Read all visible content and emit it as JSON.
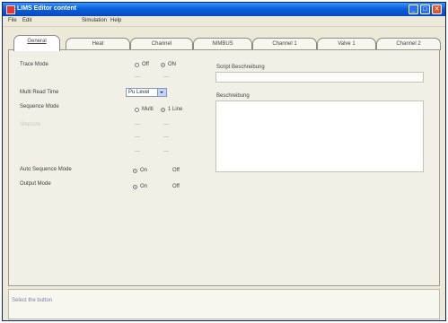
{
  "window": {
    "title": "LIMS Editor content",
    "controls": {
      "minimize": "_",
      "maximize": "□",
      "close": "✕"
    }
  },
  "menu": [
    "File",
    "Edit",
    "Simulation",
    "Help"
  ],
  "tabs": [
    "General",
    "Heat",
    "Channel",
    "NIMBUS",
    "Channel 1",
    "Valve 1",
    "Channel 2"
  ],
  "general": {
    "trace_mode": {
      "label": "Trace Mode",
      "options": [
        "Off",
        "ON"
      ],
      "selected": "ON"
    },
    "multi_read_time": {
      "label": "Multi Read Time",
      "value": "Pu Level"
    },
    "sequence_mode": {
      "label": "Sequence Mode",
      "options": [
        "Multi",
        "1 Line"
      ],
      "selected": "1 Line"
    },
    "disabled_label": "Stepsize",
    "auto_sequence_mode": {
      "label": "Auto Sequence Mode",
      "options": [
        "On",
        "Off"
      ],
      "selected": "On"
    },
    "output_mode": {
      "label": "Output Mode",
      "options": [
        "On",
        "Off"
      ],
      "selected": "On"
    }
  },
  "right": {
    "script_label": "Script Beschreibung",
    "description_label": "Beschreibung"
  },
  "status": {
    "text": "Select the button"
  }
}
